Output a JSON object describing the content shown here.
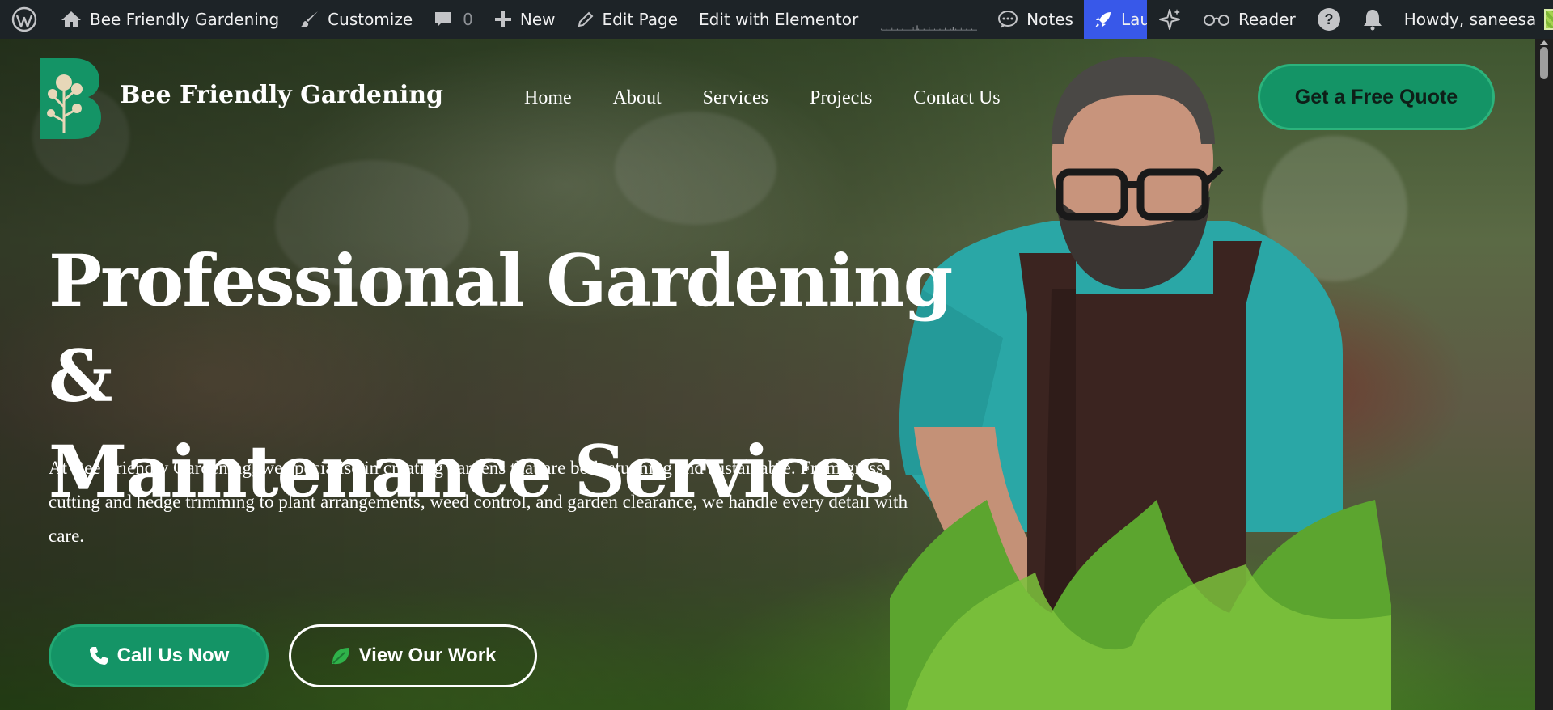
{
  "admin_bar": {
    "site_name": "Bee Friendly Gardening",
    "customize": "Customize",
    "comments_count": "0",
    "new": "New",
    "edit_page": "Edit Page",
    "edit_elementor": "Edit with Elementor",
    "notes": "Notes",
    "launch": "Launch",
    "reader": "Reader",
    "howdy": "Howdy, saneesa",
    "accent_color": "#3858e9"
  },
  "site": {
    "title": "Bee Friendly Gardening",
    "nav": [
      "Home",
      "About",
      "Services",
      "Projects",
      "Contact Us"
    ],
    "quote_button": "Get a Free Quote",
    "brand_color": "#149466"
  },
  "hero": {
    "title_line1": "Professional Gardening &",
    "title_line2": "Maintenance Services",
    "text": "At Bee Friendly Gardening, we specialise in creating gardens that are both stunning and sustainable. From grass cutting and hedge trimming to plant arrangements, weed control, and garden clearance, we handle every detail with care.",
    "cta_primary": "Call Us Now",
    "cta_secondary": "View Our Work"
  }
}
